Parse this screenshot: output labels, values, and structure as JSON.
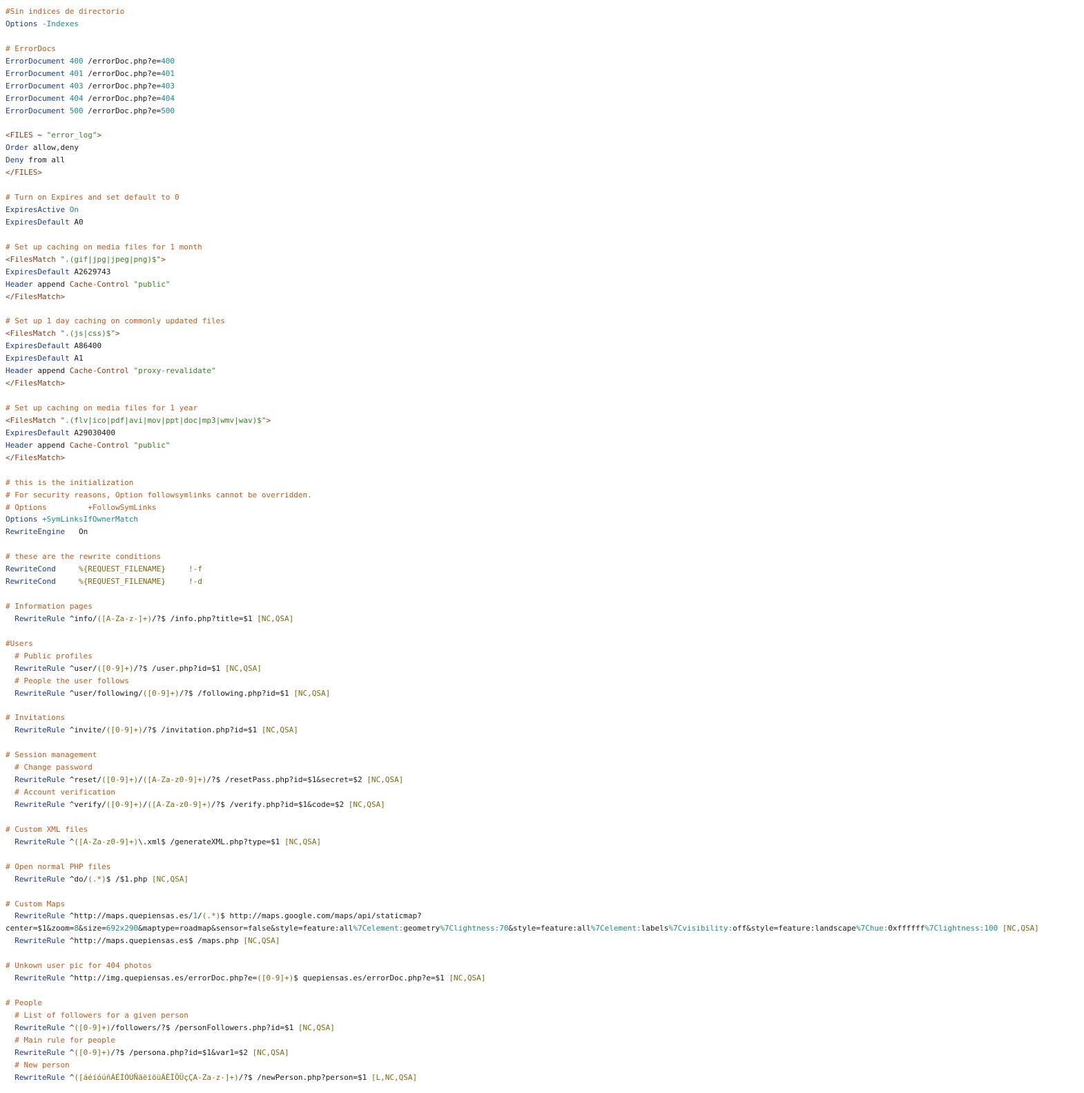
{
  "document": {
    "lines": [
      [
        [
          "c",
          "#Sin indices de directorio"
        ]
      ],
      [
        [
          "d",
          "Options"
        ],
        [
          "p",
          " "
        ],
        [
          "n",
          "-Indexes"
        ]
      ],
      [],
      [
        [
          "c",
          "# ErrorDocs"
        ]
      ],
      [
        [
          "d",
          "ErrorDocument"
        ],
        [
          "p",
          " "
        ],
        [
          "n",
          "400"
        ],
        [
          "p",
          " /errorDoc.php?e="
        ],
        [
          "n",
          "400"
        ]
      ],
      [
        [
          "d",
          "ErrorDocument"
        ],
        [
          "p",
          " "
        ],
        [
          "n",
          "401"
        ],
        [
          "p",
          " /errorDoc.php?e="
        ],
        [
          "n",
          "401"
        ]
      ],
      [
        [
          "d",
          "ErrorDocument"
        ],
        [
          "p",
          " "
        ],
        [
          "n",
          "403"
        ],
        [
          "p",
          " /errorDoc.php?e="
        ],
        [
          "n",
          "403"
        ]
      ],
      [
        [
          "d",
          "ErrorDocument"
        ],
        [
          "p",
          " "
        ],
        [
          "n",
          "404"
        ],
        [
          "p",
          " /errorDoc.php?e="
        ],
        [
          "n",
          "404"
        ]
      ],
      [
        [
          "d",
          "ErrorDocument"
        ],
        [
          "p",
          " "
        ],
        [
          "n",
          "500"
        ],
        [
          "p",
          " /errorDoc.php?e="
        ],
        [
          "n",
          "500"
        ]
      ],
      [],
      [
        [
          "t",
          "<FILES"
        ],
        [
          "p",
          " ~ "
        ],
        [
          "s",
          "\"error_log\""
        ],
        [
          "t",
          ">"
        ]
      ],
      [
        [
          "d",
          "Order"
        ],
        [
          "p",
          " allow,deny"
        ]
      ],
      [
        [
          "d",
          "Deny"
        ],
        [
          "p",
          " from all"
        ]
      ],
      [
        [
          "t",
          "</FILES>"
        ]
      ],
      [],
      [
        [
          "c",
          "# Turn on Expires and set default to 0"
        ]
      ],
      [
        [
          "d",
          "ExpiresActive"
        ],
        [
          "p",
          " "
        ],
        [
          "n",
          "On"
        ]
      ],
      [
        [
          "d",
          "ExpiresDefault"
        ],
        [
          "p",
          " A0"
        ]
      ],
      [],
      [
        [
          "c",
          "# Set up caching on media files for 1 month"
        ]
      ],
      [
        [
          "t",
          "<FilesMatch"
        ],
        [
          "p",
          " "
        ],
        [
          "s",
          "\".(gif|jpg|jpeg|png)$\""
        ],
        [
          "t",
          ">"
        ]
      ],
      [
        [
          "d",
          "ExpiresDefault"
        ],
        [
          "p",
          " A2629743"
        ]
      ],
      [
        [
          "d",
          "Header"
        ],
        [
          "p",
          " append "
        ],
        [
          "t",
          "Cache-Control"
        ],
        [
          "p",
          " "
        ],
        [
          "s",
          "\"public\""
        ]
      ],
      [
        [
          "t",
          "</FilesMatch>"
        ]
      ],
      [],
      [
        [
          "c",
          "# Set up 1 day caching on commonly updated files"
        ]
      ],
      [
        [
          "t",
          "<FilesMatch"
        ],
        [
          "p",
          " "
        ],
        [
          "s",
          "\".(js|css)$\""
        ],
        [
          "t",
          ">"
        ]
      ],
      [
        [
          "d",
          "ExpiresDefault"
        ],
        [
          "p",
          " A86400"
        ]
      ],
      [
        [
          "d",
          "ExpiresDefault"
        ],
        [
          "p",
          " A1"
        ]
      ],
      [
        [
          "d",
          "Header"
        ],
        [
          "p",
          " append "
        ],
        [
          "t",
          "Cache-Control"
        ],
        [
          "p",
          " "
        ],
        [
          "s",
          "\"proxy-revalidate\""
        ]
      ],
      [
        [
          "t",
          "</FilesMatch>"
        ]
      ],
      [],
      [
        [
          "c",
          "# Set up caching on media files for 1 year"
        ]
      ],
      [
        [
          "t",
          "<FilesMatch"
        ],
        [
          "p",
          " "
        ],
        [
          "s",
          "\".(flv|ico|pdf|avi|mov|ppt|doc|mp3|wmv|wav)$\""
        ],
        [
          "t",
          ">"
        ]
      ],
      [
        [
          "d",
          "ExpiresDefault"
        ],
        [
          "p",
          " A29030400"
        ]
      ],
      [
        [
          "d",
          "Header"
        ],
        [
          "p",
          " append "
        ],
        [
          "t",
          "Cache-Control"
        ],
        [
          "p",
          " "
        ],
        [
          "s",
          "\"public\""
        ]
      ],
      [
        [
          "t",
          "</FilesMatch>"
        ]
      ],
      [],
      [
        [
          "c",
          "# this is the initialization"
        ]
      ],
      [
        [
          "c",
          "# For security reasons, Option followsymlinks cannot be overridden."
        ]
      ],
      [
        [
          "c",
          "# Options         +FollowSymLinks"
        ]
      ],
      [
        [
          "d",
          "Options"
        ],
        [
          "p",
          " "
        ],
        [
          "n",
          "+SymLinksIfOwnerMatch"
        ]
      ],
      [
        [
          "d",
          "RewriteEngine"
        ],
        [
          "p",
          "   On"
        ]
      ],
      [],
      [
        [
          "c",
          "# these are the rewrite conditions"
        ]
      ],
      [
        [
          "d",
          "RewriteCond"
        ],
        [
          "p",
          "     "
        ],
        [
          "r",
          "%{REQUEST_FILENAME}"
        ],
        [
          "p",
          "     "
        ],
        [
          "r",
          "!-f"
        ]
      ],
      [
        [
          "d",
          "RewriteCond"
        ],
        [
          "p",
          "     "
        ],
        [
          "r",
          "%{REQUEST_FILENAME}"
        ],
        [
          "p",
          "     "
        ],
        [
          "r",
          "!-d"
        ]
      ],
      [],
      [
        [
          "c",
          "# Information pages"
        ]
      ],
      [
        [
          "p",
          "  "
        ],
        [
          "d",
          "RewriteRule"
        ],
        [
          "p",
          " ^info/"
        ],
        [
          "r",
          "([A-Za-z-]+)"
        ],
        [
          "p",
          "/?$ /info.php?title=$1 "
        ],
        [
          "r",
          "[NC,QSA]"
        ]
      ],
      [],
      [
        [
          "c",
          "#Users"
        ]
      ],
      [
        [
          "p",
          "  "
        ],
        [
          "c",
          "# Public profiles"
        ]
      ],
      [
        [
          "p",
          "  "
        ],
        [
          "d",
          "RewriteRule"
        ],
        [
          "p",
          " ^user/"
        ],
        [
          "r",
          "([0-9]+)"
        ],
        [
          "p",
          "/?$ /user.php?id=$1 "
        ],
        [
          "r",
          "[NC,QSA]"
        ]
      ],
      [
        [
          "p",
          "  "
        ],
        [
          "c",
          "# People the user follows"
        ]
      ],
      [
        [
          "p",
          "  "
        ],
        [
          "d",
          "RewriteRule"
        ],
        [
          "p",
          " ^user/following/"
        ],
        [
          "r",
          "([0-9]+)"
        ],
        [
          "p",
          "/?$ /following.php?id=$1 "
        ],
        [
          "r",
          "[NC,QSA]"
        ]
      ],
      [],
      [
        [
          "c",
          "# Invitations"
        ]
      ],
      [
        [
          "p",
          "  "
        ],
        [
          "d",
          "RewriteRule"
        ],
        [
          "p",
          " ^invite/"
        ],
        [
          "r",
          "([0-9]+)"
        ],
        [
          "p",
          "/?$ /invitation.php?id=$1 "
        ],
        [
          "r",
          "[NC,QSA]"
        ]
      ],
      [],
      [
        [
          "c",
          "# Session management"
        ]
      ],
      [
        [
          "p",
          "  "
        ],
        [
          "c",
          "# Change password"
        ]
      ],
      [
        [
          "p",
          "  "
        ],
        [
          "d",
          "RewriteRule"
        ],
        [
          "p",
          " ^reset/"
        ],
        [
          "r",
          "([0-9]+)"
        ],
        [
          "p",
          "/"
        ],
        [
          "r",
          "([A-Za-z0-9]+)"
        ],
        [
          "p",
          "/?$ /resetPass.php?id=$1&secret=$2 "
        ],
        [
          "r",
          "[NC,QSA]"
        ]
      ],
      [
        [
          "p",
          "  "
        ],
        [
          "c",
          "# Account verification"
        ]
      ],
      [
        [
          "p",
          "  "
        ],
        [
          "d",
          "RewriteRule"
        ],
        [
          "p",
          " ^verify/"
        ],
        [
          "r",
          "([0-9]+)"
        ],
        [
          "p",
          "/"
        ],
        [
          "r",
          "([A-Za-z0-9]+)"
        ],
        [
          "p",
          "/?$ /verify.php?id=$1&code=$2 "
        ],
        [
          "r",
          "[NC,QSA]"
        ]
      ],
      [],
      [
        [
          "c",
          "# Custom XML files"
        ]
      ],
      [
        [
          "p",
          "  "
        ],
        [
          "d",
          "RewriteRule"
        ],
        [
          "p",
          " ^"
        ],
        [
          "r",
          "([A-Za-z0-9]+)"
        ],
        [
          "p",
          "\\.xml$ /generateXML.php?type=$1 "
        ],
        [
          "r",
          "[NC,QSA]"
        ]
      ],
      [],
      [
        [
          "c",
          "# Open normal PHP files"
        ]
      ],
      [
        [
          "p",
          "  "
        ],
        [
          "d",
          "RewriteRule"
        ],
        [
          "p",
          " ^do/"
        ],
        [
          "r",
          "(.*)"
        ],
        [
          "p",
          "$ /$1.php "
        ],
        [
          "r",
          "[NC,QSA]"
        ]
      ],
      [],
      [
        [
          "c",
          "# Custom Maps"
        ]
      ],
      [
        [
          "p",
          "  "
        ],
        [
          "d",
          "RewriteRule"
        ],
        [
          "p",
          " ^http://maps.quepiensas.es/"
        ],
        [
          "n",
          "1"
        ],
        [
          "p",
          "/"
        ],
        [
          "r",
          "(.*)"
        ],
        [
          "p",
          "$ http://maps.google.com/maps/api/staticmap?"
        ]
      ],
      [
        [
          "p",
          "center=$1&zoom="
        ],
        [
          "n",
          "8"
        ],
        [
          "p",
          "&size="
        ],
        [
          "n",
          "692x290"
        ],
        [
          "p",
          "&maptype=roadmap&sensor=false&style=feature:all"
        ],
        [
          "n",
          "%7Celement:"
        ],
        [
          "p",
          "geometry"
        ],
        [
          "n",
          "%7Clightness:70"
        ],
        [
          "p",
          "&style=feature:all"
        ],
        [
          "n",
          "%7Celement:"
        ],
        [
          "p",
          "labels"
        ],
        [
          "n",
          "%7Cvisibility:"
        ],
        [
          "p",
          "off&style=feature:landscape"
        ],
        [
          "n",
          "%7Chue:"
        ],
        [
          "p",
          "0xffffff"
        ],
        [
          "n",
          "%7Clightness:100"
        ],
        [
          "p",
          " "
        ],
        [
          "r",
          "[NC,QSA]"
        ]
      ],
      [
        [
          "p",
          "  "
        ],
        [
          "d",
          "RewriteRule"
        ],
        [
          "p",
          " ^http://maps.quepiensas.es$ /maps.php "
        ],
        [
          "r",
          "[NC,QSA]"
        ]
      ],
      [],
      [
        [
          "c",
          "# Unkown user pic for 404 photos"
        ]
      ],
      [
        [
          "p",
          "  "
        ],
        [
          "d",
          "RewriteRule"
        ],
        [
          "p",
          " ^http://img.quepiensas.es/errorDoc.php?e="
        ],
        [
          "r",
          "([0-9]+)"
        ],
        [
          "p",
          "$ quepiensas.es/errorDoc.php?e=$1 "
        ],
        [
          "r",
          "[NC,QSA]"
        ]
      ],
      [],
      [
        [
          "c",
          "# People"
        ]
      ],
      [
        [
          "p",
          "  "
        ],
        [
          "c",
          "# List of followers for a given person"
        ]
      ],
      [
        [
          "p",
          "  "
        ],
        [
          "d",
          "RewriteRule"
        ],
        [
          "p",
          " ^"
        ],
        [
          "r",
          "([0-9]+)"
        ],
        [
          "p",
          "/followers/?$ /personFollowers.php?id=$1 "
        ],
        [
          "r",
          "[NC,QSA]"
        ]
      ],
      [
        [
          "p",
          "  "
        ],
        [
          "c",
          "# Main rule for people"
        ]
      ],
      [
        [
          "p",
          "  "
        ],
        [
          "d",
          "RewriteRule"
        ],
        [
          "p",
          " ^"
        ],
        [
          "r",
          "([0-9]+)"
        ],
        [
          "p",
          "/?$ /persona.php?id=$1&var1=$2 "
        ],
        [
          "r",
          "[NC,QSA]"
        ]
      ],
      [
        [
          "p",
          "  "
        ],
        [
          "c",
          "# New person"
        ]
      ],
      [
        [
          "p",
          "  "
        ],
        [
          "d",
          "RewriteRule"
        ],
        [
          "p",
          " ^"
        ],
        [
          "r",
          "([áéíóúñÁÉÍÓÚÑäëïöüÄËÏÖÜçÇA-Za-z-]+)"
        ],
        [
          "p",
          "/?$ /newPerson.php?person=$1 "
        ],
        [
          "r",
          "[L,NC,QSA]"
        ]
      ]
    ]
  }
}
